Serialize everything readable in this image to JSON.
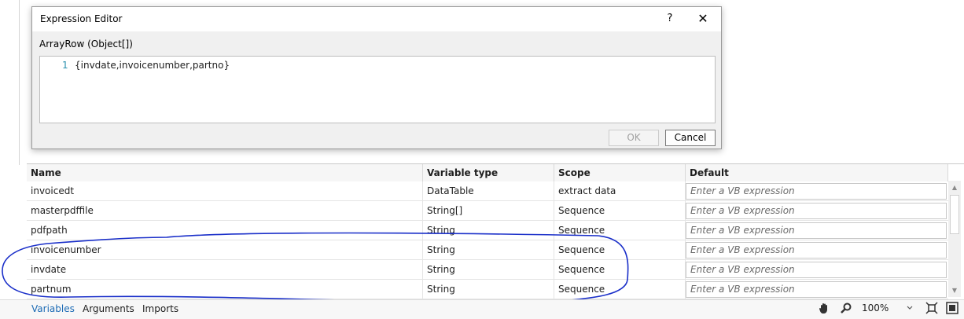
{
  "dialog": {
    "title": "Expression Editor",
    "help": "?",
    "close": "✕",
    "type_label": "ArrayRow (Object[])",
    "line_number": "1",
    "code": "{invdate,invoicenumber,partno}",
    "ok_label": "OK",
    "cancel_label": "Cancel"
  },
  "grid": {
    "headers": [
      "Name",
      "Variable type",
      "Scope",
      "Default"
    ],
    "placeholder": "Enter a VB expression",
    "rows": [
      {
        "name": "invoicedt",
        "type": "DataTable",
        "scope": "extract data"
      },
      {
        "name": "masterpdffile",
        "type": "String[]",
        "scope": "Sequence"
      },
      {
        "name": "pdfpath",
        "type": "String",
        "scope": "Sequence"
      },
      {
        "name": "invoicenumber",
        "type": "String",
        "scope": "Sequence"
      },
      {
        "name": "invdate",
        "type": "String",
        "scope": "Sequence"
      },
      {
        "name": "partnum",
        "type": "String",
        "scope": "Sequence"
      }
    ]
  },
  "tabs": {
    "variables": "Variables",
    "arguments": "Arguments",
    "imports": "Imports"
  },
  "status": {
    "zoom": "100%",
    "icons": [
      "hand-icon",
      "magnifier-icon",
      "chevron-down-icon",
      "fit-to-screen-icon",
      "overview-icon"
    ]
  },
  "colors": {
    "active_tab": "#1c6bb5",
    "annotation": "#1a2fc9"
  }
}
